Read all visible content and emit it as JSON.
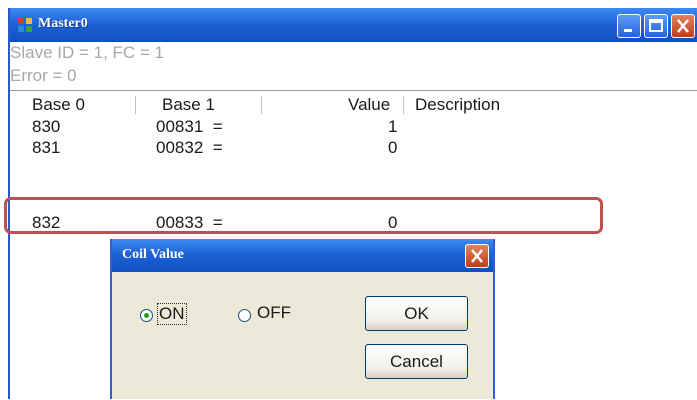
{
  "window": {
    "title": "Master0"
  },
  "status": {
    "line1": "Slave ID = 1, FC = 1",
    "line2": "Error = 0"
  },
  "table": {
    "columns": [
      "Base 0",
      "Base 1",
      "Value",
      "Description"
    ],
    "rows": [
      {
        "base0": "830",
        "base1": "00831  =",
        "value": "1",
        "description": ""
      },
      {
        "base0": "831",
        "base1": "00832  =",
        "value": "0",
        "description": ""
      },
      {
        "base0": "832",
        "base1": "00833  =",
        "value": "0",
        "description": ""
      }
    ]
  },
  "dialog": {
    "title": "Coil Value",
    "radio_on": "ON",
    "radio_off": "OFF",
    "selected": "ON",
    "ok_label": "OK",
    "cancel_label": "Cancel"
  },
  "colors": {
    "titlebar": "#1f63d6",
    "highlight": "#c0504d",
    "dialog_bg": "#ece9d8"
  }
}
